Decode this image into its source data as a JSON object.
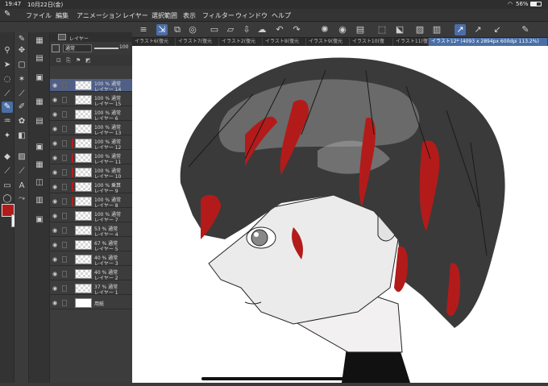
{
  "status": {
    "time": "19:47",
    "date": "10月22日(金)",
    "battery": "56%"
  },
  "menu": [
    "ファイル",
    "編集",
    "アニメーション",
    "レイヤー",
    "選択範囲",
    "表示",
    "フィルター",
    "ウィンドウ",
    "ヘルプ"
  ],
  "tabs": [
    "イラスト6(復元",
    "イラスト7(復元",
    "イラスト2(復元",
    "イラスト8(復元",
    "イラスト9(復元",
    "イラスト10(復",
    "イラスト11(復",
    "イラスト12* (4093 x 2894px 600dpi 113.2%)"
  ],
  "layer_panel": {
    "title": "レイヤー",
    "blend_mode": "通常",
    "opacity": "100",
    "layers": [
      {
        "line1": "100 % 通常",
        "line2": "レイヤー 14",
        "active": true,
        "mark": false
      },
      {
        "line1": "100 % 通常",
        "line2": "レイヤー 15",
        "active": false,
        "mark": false
      },
      {
        "line1": "100 % 通常",
        "line2": "レイヤー 6",
        "active": false,
        "mark": false
      },
      {
        "line1": "100 % 通常",
        "line2": "レイヤー 13",
        "active": false,
        "mark": false
      },
      {
        "line1": "100 % 通常",
        "line2": "レイヤー 12",
        "active": false,
        "mark": true
      },
      {
        "line1": "100 % 通常",
        "line2": "レイヤー 11",
        "active": false,
        "mark": true
      },
      {
        "line1": "100 % 通常",
        "line2": "レイヤー 10",
        "active": false,
        "mark": true
      },
      {
        "line1": "100 % 乗算",
        "line2": "レイヤー 9",
        "active": false,
        "mark": true
      },
      {
        "line1": "100 % 通常",
        "line2": "レイヤー 8",
        "active": false,
        "mark": true
      },
      {
        "line1": "100 % 通常",
        "line2": "レイヤー 7",
        "active": false,
        "mark": false
      },
      {
        "line1": "53 % 通常",
        "line2": "レイヤー 4",
        "active": false,
        "mark": false
      },
      {
        "line1": "67 % 通常",
        "line2": "レイヤー 5",
        "active": false,
        "mark": false
      },
      {
        "line1": "40 % 通常",
        "line2": "レイヤー 3",
        "active": false,
        "mark": false
      },
      {
        "line1": "40 % 通常",
        "line2": "レイヤー 2",
        "active": false,
        "mark": false
      },
      {
        "line1": "37 % 通常",
        "line2": "レイヤー 1",
        "active": false,
        "mark": false
      },
      {
        "line1": "",
        "line2": "用紙",
        "active": false,
        "mark": false,
        "paper": true
      }
    ]
  },
  "colors": {
    "main": "#b31b1b",
    "sub": "#f2f2f2",
    "accent": "#4a6fa7"
  }
}
